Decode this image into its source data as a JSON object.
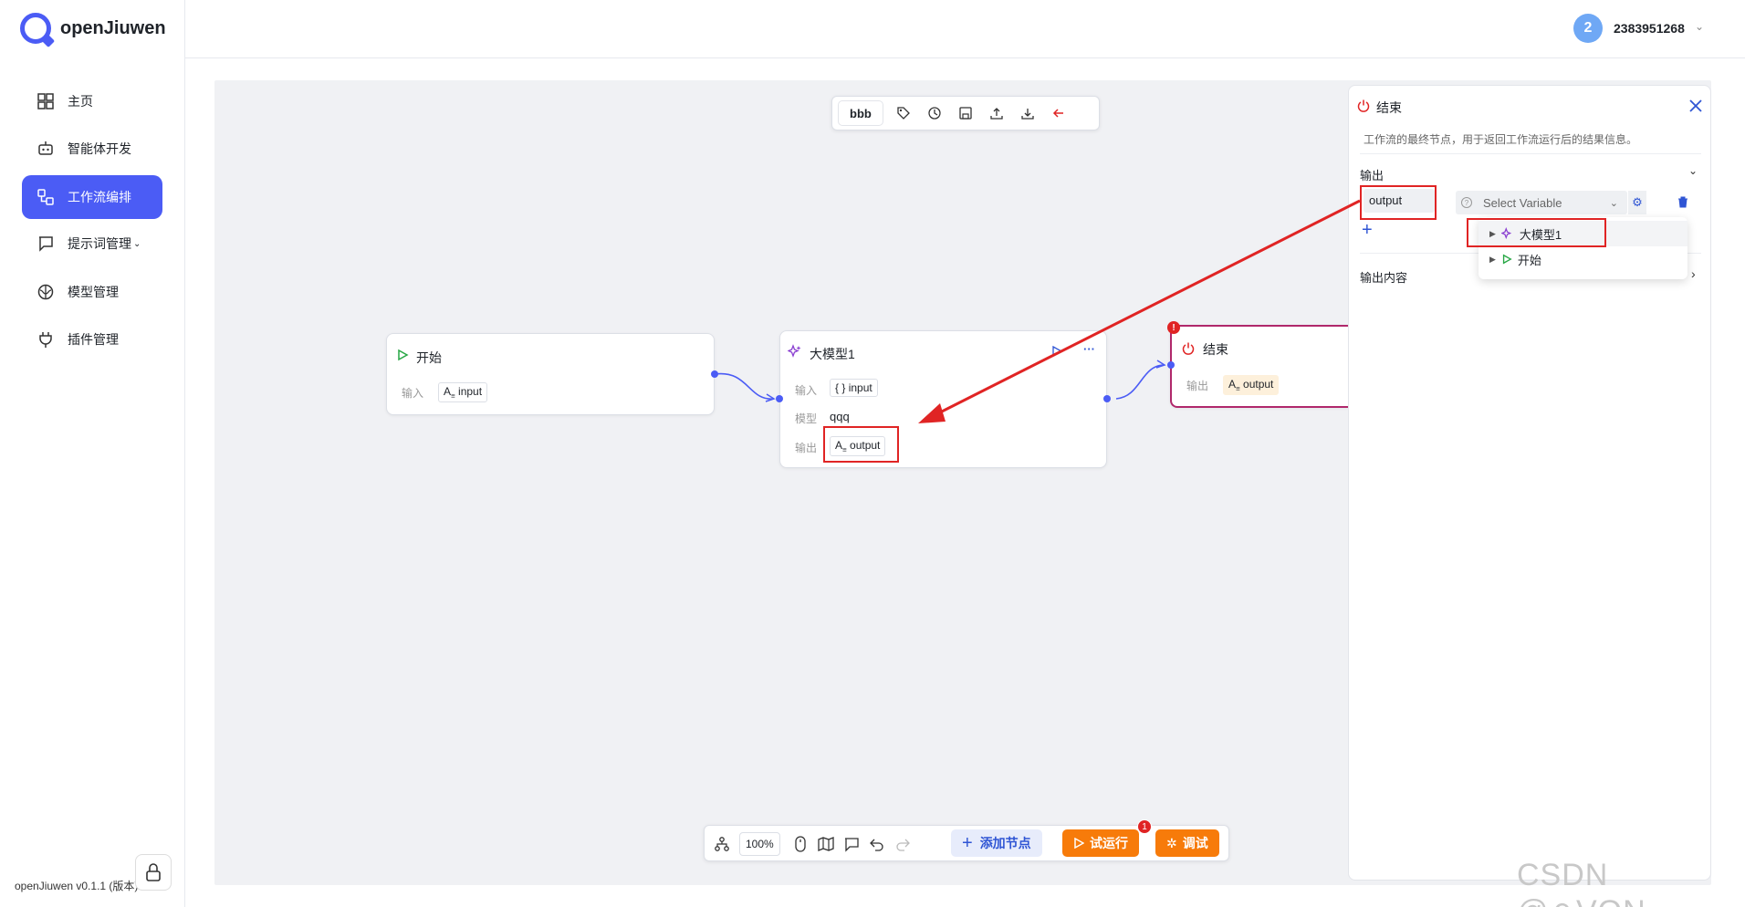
{
  "app": {
    "name": "openJiuwen",
    "version": "openJiuwen v0.1.1 (版本)"
  },
  "sidebar": {
    "items": [
      {
        "label": "主页",
        "icon": "dashboard-icon"
      },
      {
        "label": "智能体开发",
        "icon": "robot-icon"
      },
      {
        "label": "工作流编排",
        "icon": "workflow-icon",
        "active": true
      },
      {
        "label": "提示词管理",
        "icon": "chat-icon",
        "has_submenu": true
      },
      {
        "label": "模型管理",
        "icon": "brain-icon"
      },
      {
        "label": "插件管理",
        "icon": "plug-icon"
      }
    ]
  },
  "header": {
    "avatar_text": "2",
    "username": "2383951268"
  },
  "canvas_toolbar": {
    "name": "bbb"
  },
  "nodes": {
    "start": {
      "title": "开始",
      "input_label": "输入",
      "input_value": "input"
    },
    "llm": {
      "title": "大模型1",
      "input_label": "输入",
      "input_value": "input",
      "model_label": "模型",
      "model_value": "qqq",
      "output_label": "输出",
      "output_value": "output",
      "more": "···"
    },
    "end": {
      "title": "结束",
      "output_label": "输出",
      "output_value": "output",
      "error_badge": "!"
    }
  },
  "bottom_toolbar": {
    "zoom": "100%",
    "add_node": "添加节点",
    "trial_run": "试运行",
    "trial_badge": "1",
    "debug": "调试"
  },
  "panel": {
    "title": "结束",
    "description": "工作流的最终节点，用于返回工作流运行后的结果信息。",
    "output_section": "输出",
    "output_name": "output",
    "select_placeholder": "Select Variable",
    "output_content": "输出内容",
    "dropdown_items": [
      "大模型1",
      "开始"
    ]
  },
  "watermark": "CSDN @⚪VON",
  "colors": {
    "accent": "#4b5cf5",
    "orange": "#f77b0a",
    "error": "#e02424",
    "end_node_border": "#b0286b"
  }
}
